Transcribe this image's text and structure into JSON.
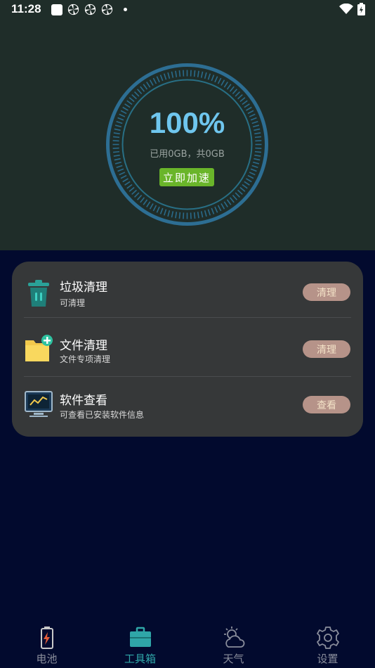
{
  "status_bar": {
    "time": "11:28"
  },
  "gauge": {
    "percent": "100%",
    "usage": "已用0GB，共0GB",
    "boost_label": "立即加速"
  },
  "tools": [
    {
      "title": "垃圾清理",
      "subtitle": "可清理",
      "action": "清理",
      "icon": "trash-icon"
    },
    {
      "title": "文件清理",
      "subtitle": "文件专项清理",
      "action": "清理",
      "icon": "folder-add-icon"
    },
    {
      "title": "软件查看",
      "subtitle": "可查看已安装软件信息",
      "action": "查看",
      "icon": "monitor-icon"
    }
  ],
  "nav": {
    "items": [
      {
        "label": "电池",
        "icon": "battery-icon",
        "active": false
      },
      {
        "label": "工具箱",
        "icon": "toolbox-icon",
        "active": true
      },
      {
        "label": "天气",
        "icon": "weather-icon",
        "active": false
      },
      {
        "label": "设置",
        "icon": "gear-icon",
        "active": false
      }
    ]
  },
  "colors": {
    "background": "#020a2e",
    "hero": "#1f2d29",
    "card": "#363839",
    "accent": "#2fa6a8",
    "boost": "#6ab52a",
    "action_button": "#b69389",
    "gauge_text": "#6fc6ee"
  }
}
